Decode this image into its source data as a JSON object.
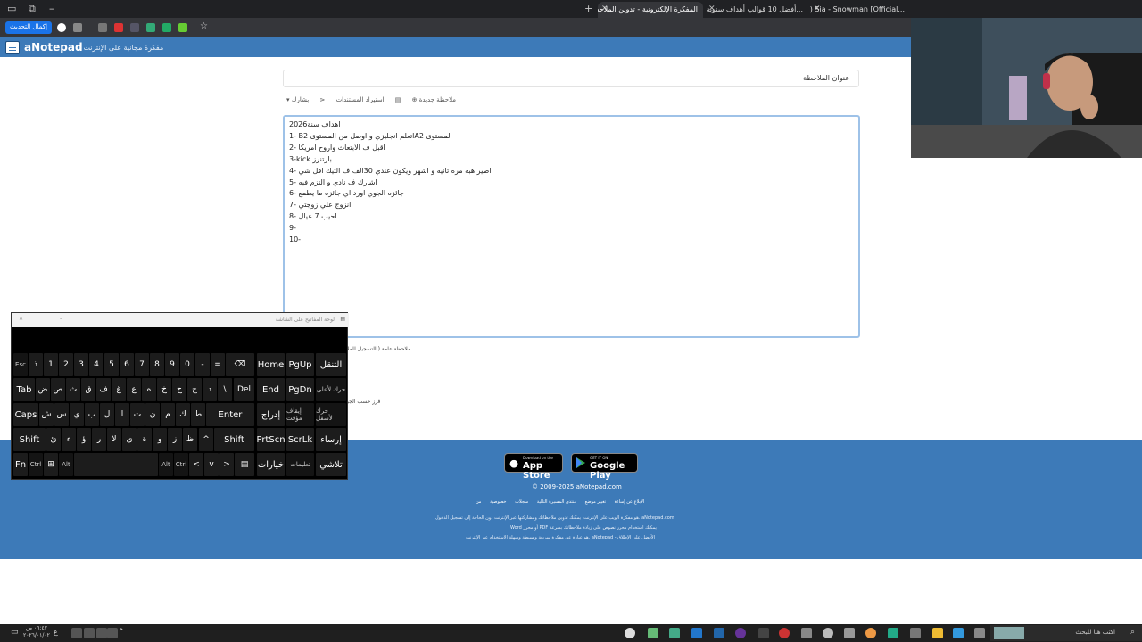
{
  "browser": {
    "tabs": [
      {
        "title": "(896) Sia - Snowman [Official..."
      },
      {
        "title": "أفضل 10 قوالب أهداف سنوية م..."
      },
      {
        "title": "المفكرة الإلكترونية - تدوين الملاحظات"
      }
    ],
    "update_button": "إكمال التحديث",
    "new_tab": "+"
  },
  "site": {
    "brand": "aNotepad",
    "tagline": "- مفكرة مجانية على الإنترنت"
  },
  "note": {
    "title_placeholder": "عنوان الملاحظة",
    "tools": {
      "new_note": "ملاحظة جديدة",
      "import_docs": "استيراد المستندات",
      "share": "بشارك"
    },
    "lines": [
      "اهداف سنة2026",
      "1- B2 اتعلم انجليزي و اوصل من المستوىA2  لمستوى",
      "2- اقبل ف الابتعاث واروح امريكا",
      "3-kick بارتنرز",
      "4- اصير  هبه مره ثانيه و اشهر  ويكون عندي 30الف ف التيك اقل شي",
      "5- اشارك ف نادي و التزم فيه",
      "6- جائزه الجوي اورد اي جائزه ما يطمع",
      "7- انزوج علي زوجتي",
      "8- احيب 7 عيال",
      "9-",
      "10-"
    ],
    "below_label": "ملاحظة عامة ( التسجيل للملا",
    "below_label2": "فرز حسب الجو"
  },
  "footer": {
    "app_store_small": "Download on the",
    "app_store": "App Store",
    "google_play_small": "GET IT ON",
    "google_play": "Google Play",
    "copyright": "© 2009-2025 aNotepad.com",
    "links": [
      "من",
      "خصوصية",
      "سجلات",
      "منتدى المسيرة التالية",
      "تغيير موضع",
      "الإبلاغ عن إساءة"
    ],
    "desc1": "هو مفكرة الويب على الإنترنت. يمكنك تدوين ملاحظاتك ومشاركتها عبر الإنترنت دون الحاجة إلى تسجيل الدخول. aNotepad.com",
    "desc2": "Word أو محرر PDF يمكنك استخدام محرر نصوص على زيادة ملاحظاتك بسرعة",
    "desc3": "هو عبارة عن مفكرة سريعة وبسيطة وسهلة الاستخدام عبر الإنترنت. aNotepad - الأفضل على الإطلاق"
  },
  "keyboard": {
    "title": "لوحة المفاتيح على الشاشة",
    "row1": [
      "Esc",
      "ذ",
      "1",
      "2",
      "3",
      "4",
      "5",
      "6",
      "7",
      "8",
      "9",
      "0",
      "-",
      "="
    ],
    "row2": [
      "Tab",
      "ض",
      "ص",
      "ث",
      "ق",
      "ف",
      "غ",
      "ع",
      "ه",
      "خ",
      "ح",
      "ج",
      "د",
      "\\"
    ],
    "row3": [
      "Caps",
      "ش",
      "س",
      "ي",
      "ب",
      "ل",
      "ا",
      "ت",
      "ن",
      "م",
      "ك",
      "ط"
    ],
    "row4": [
      "Shift",
      "ئ",
      "ء",
      "ؤ",
      "ر",
      "لا",
      "ى",
      "ة",
      "و",
      "ز",
      "ظ"
    ],
    "row5": [
      "Fn",
      "Ctrl",
      "Alt",
      "Alt",
      "Ctrl"
    ],
    "backspace": "⌫",
    "del": "Del",
    "enter": "Enter",
    "shift_r": "Shift",
    "nav": [
      "Home",
      "PgUp",
      "End",
      "PgDn",
      "إدراج",
      "إيقاف مؤقت",
      "PrtScn",
      "ScrLk",
      "خيارات",
      "تعليمات"
    ],
    "right_col": [
      "التنقل",
      "حرك لأعلى",
      "حرك لأسفل",
      "إرساء",
      "تلاشي"
    ]
  },
  "taskbar": {
    "search": "اكتب هنا للبحث",
    "time": "٠٦:٤٢ ص",
    "date": "٢٠٢٦/٠١/٠٢"
  }
}
